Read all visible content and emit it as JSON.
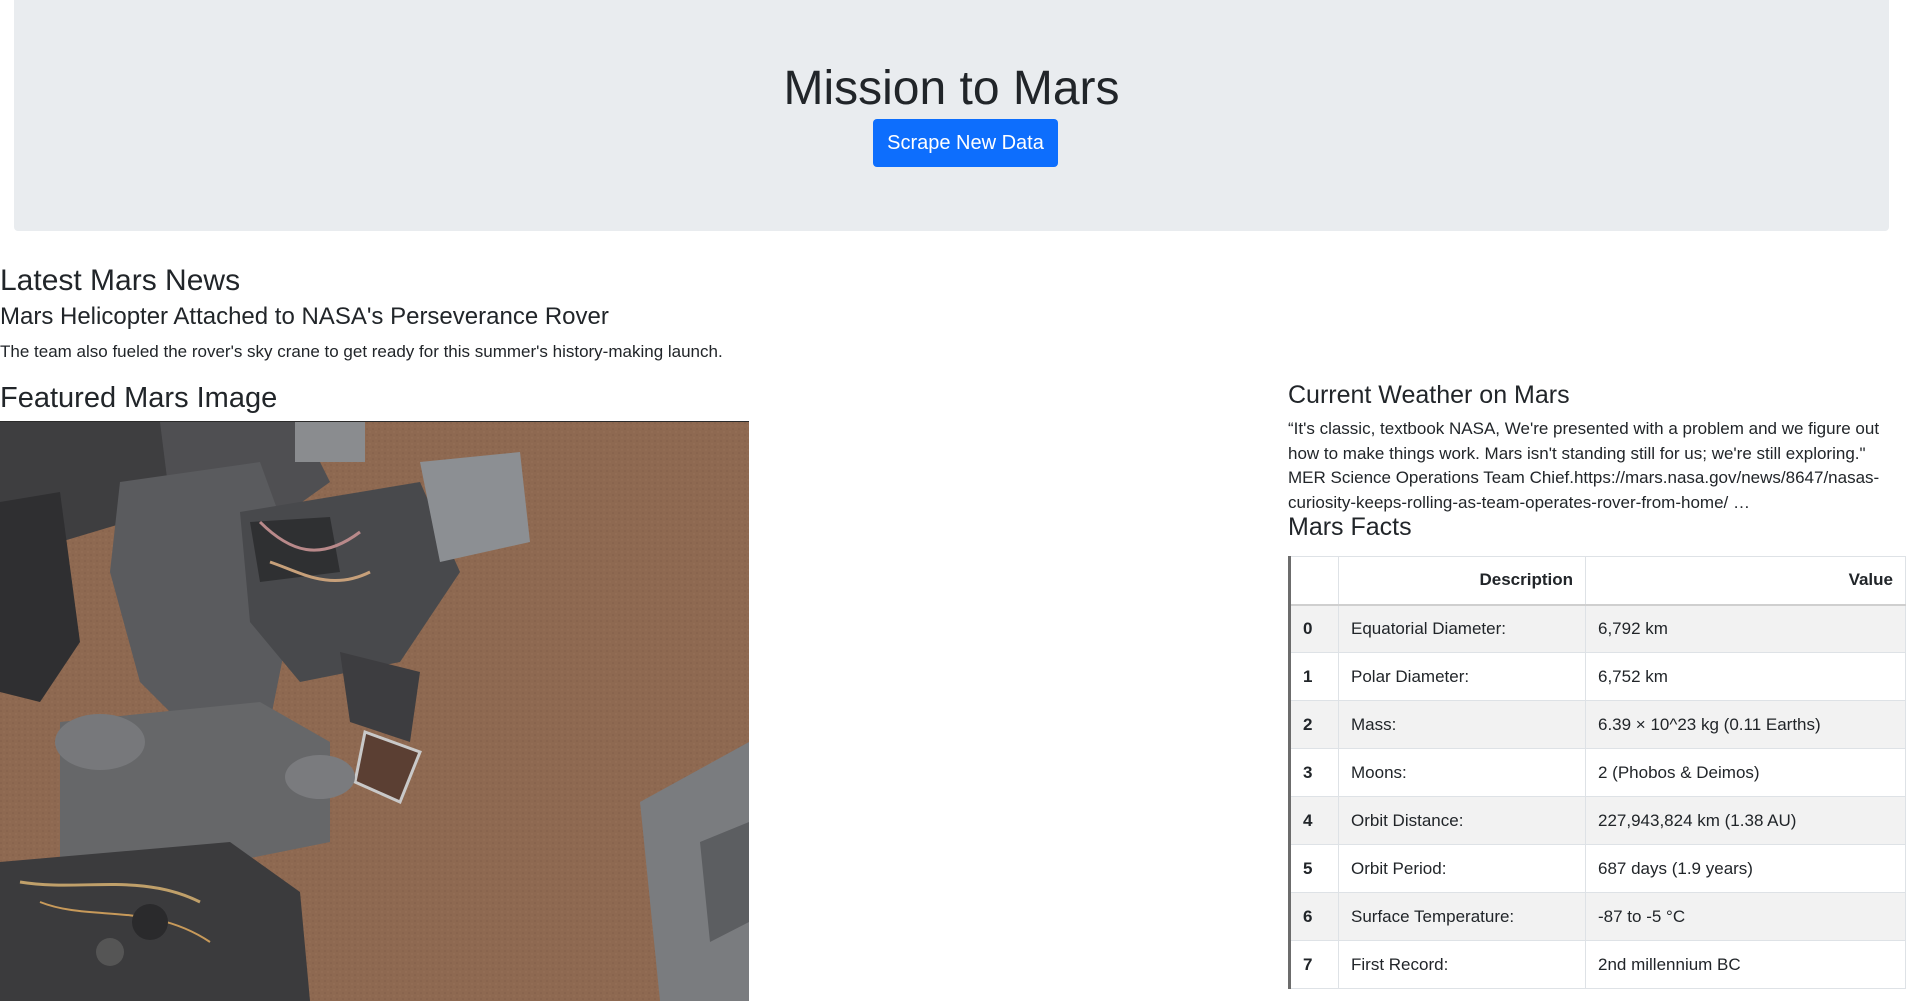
{
  "header": {
    "title": "Mission to Mars",
    "scrape_button": "Scrape New Data"
  },
  "news": {
    "heading": "Latest Mars News",
    "title": "Mars Helicopter Attached to NASA's Perseverance Rover",
    "teaser": "The team also fueled the rover's sky crane to get ready for this summer's history-making launch."
  },
  "featured": {
    "heading": "Featured Mars Image"
  },
  "weather": {
    "heading": "Current Weather on Mars",
    "text": "“It's classic, textbook NASA, We're presented with a problem and we figure out how to make things work. Mars isn't standing still for us; we're still exploring.\" MER Science Operations Team Chief.https://mars.nasa.gov/news/8647/nasas-curiosity-keeps-rolling-as-team-operates-rover-from-home/ …"
  },
  "facts": {
    "heading": "Mars Facts",
    "columns": [
      "",
      "Description",
      "Value"
    ],
    "rows": [
      {
        "index": "0",
        "description": "Equatorial Diameter:",
        "value": "6,792 km"
      },
      {
        "index": "1",
        "description": "Polar Diameter:",
        "value": "6,752 km"
      },
      {
        "index": "2",
        "description": "Mass:",
        "value": "6.39 × 10^23 kg (0.11 Earths)"
      },
      {
        "index": "3",
        "description": "Moons:",
        "value": "2 (Phobos & Deimos)"
      },
      {
        "index": "4",
        "description": "Orbit Distance:",
        "value": "227,943,824 km (1.38 AU)"
      },
      {
        "index": "5",
        "description": "Orbit Period:",
        "value": "687 days (1.9 years)"
      },
      {
        "index": "6",
        "description": "Surface Temperature:",
        "value": "-87 to -5 °C"
      },
      {
        "index": "7",
        "description": "First Record:",
        "value": "2nd millennium BC"
      }
    ]
  }
}
